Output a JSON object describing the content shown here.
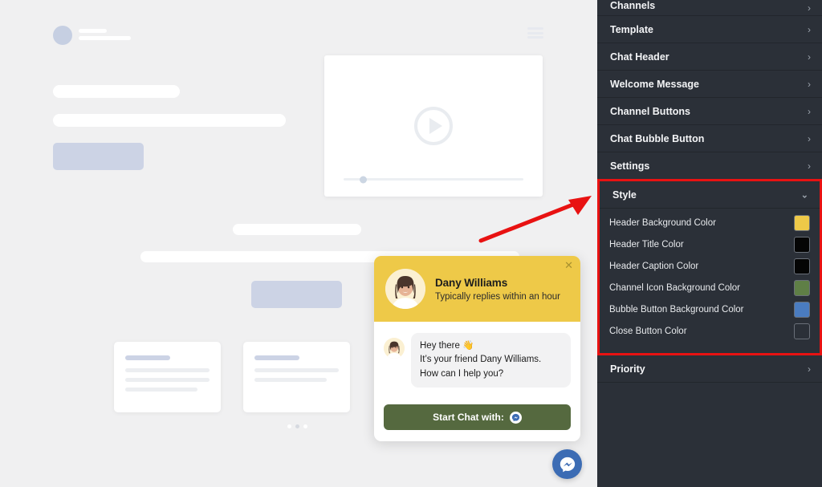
{
  "preview": {
    "video_player": {
      "play_icon": "play-triangle-icon",
      "progress_percent": 5
    },
    "menu_icon": "hamburger-menu-icon",
    "carousel_dots": 3,
    "carousel_active_index": 1
  },
  "widget": {
    "header": {
      "name": "Dany Williams",
      "caption": "Typically replies within an hour",
      "close_icon": "close-x-icon",
      "avatar": "agent-avatar",
      "background_color": "#eec948",
      "title_color": "#1d1d1d"
    },
    "message": {
      "line1": "Hey there 👋",
      "line2": "It’s your friend Dany Williams. How can I help you?",
      "avatar": "agent-avatar-small"
    },
    "cta": {
      "label": "Start Chat with:",
      "icon": "messenger-icon",
      "background_color": "#55693f"
    },
    "bubble_button": {
      "icon": "messenger-icon",
      "background_color": "#3c6cb4"
    }
  },
  "sidebar": {
    "items": [
      {
        "label": "Channels",
        "icon": "chevron-right-icon"
      },
      {
        "label": "Template",
        "icon": "chevron-right-icon"
      },
      {
        "label": "Chat Header",
        "icon": "chevron-right-icon"
      },
      {
        "label": "Welcome Message",
        "icon": "chevron-right-icon"
      },
      {
        "label": "Channel Buttons",
        "icon": "chevron-right-icon"
      },
      {
        "label": "Chat Bubble Button",
        "icon": "chevron-right-icon"
      },
      {
        "label": "Settings",
        "icon": "chevron-right-icon"
      }
    ],
    "style_section": {
      "label": "Style",
      "icon": "chevron-down-icon",
      "expanded": true,
      "highlight_color": "#e81212",
      "options": [
        {
          "label": "Header Background Color",
          "color": "#eec948"
        },
        {
          "label": "Header Title Color",
          "color": "#050505"
        },
        {
          "label": "Header Caption Color",
          "color": "#050505"
        },
        {
          "label": "Channel Icon Background Color",
          "color": "#5f7f46"
        },
        {
          "label": "Bubble Button Background Color",
          "color": "#4a7cc0"
        },
        {
          "label": "Close Button Color",
          "color": "#2b3038"
        }
      ]
    },
    "footer_items": [
      {
        "label": "Priority",
        "icon": "chevron-right-icon"
      }
    ]
  },
  "annotation": {
    "arrow_color": "#e81212",
    "points_to": "Style"
  }
}
